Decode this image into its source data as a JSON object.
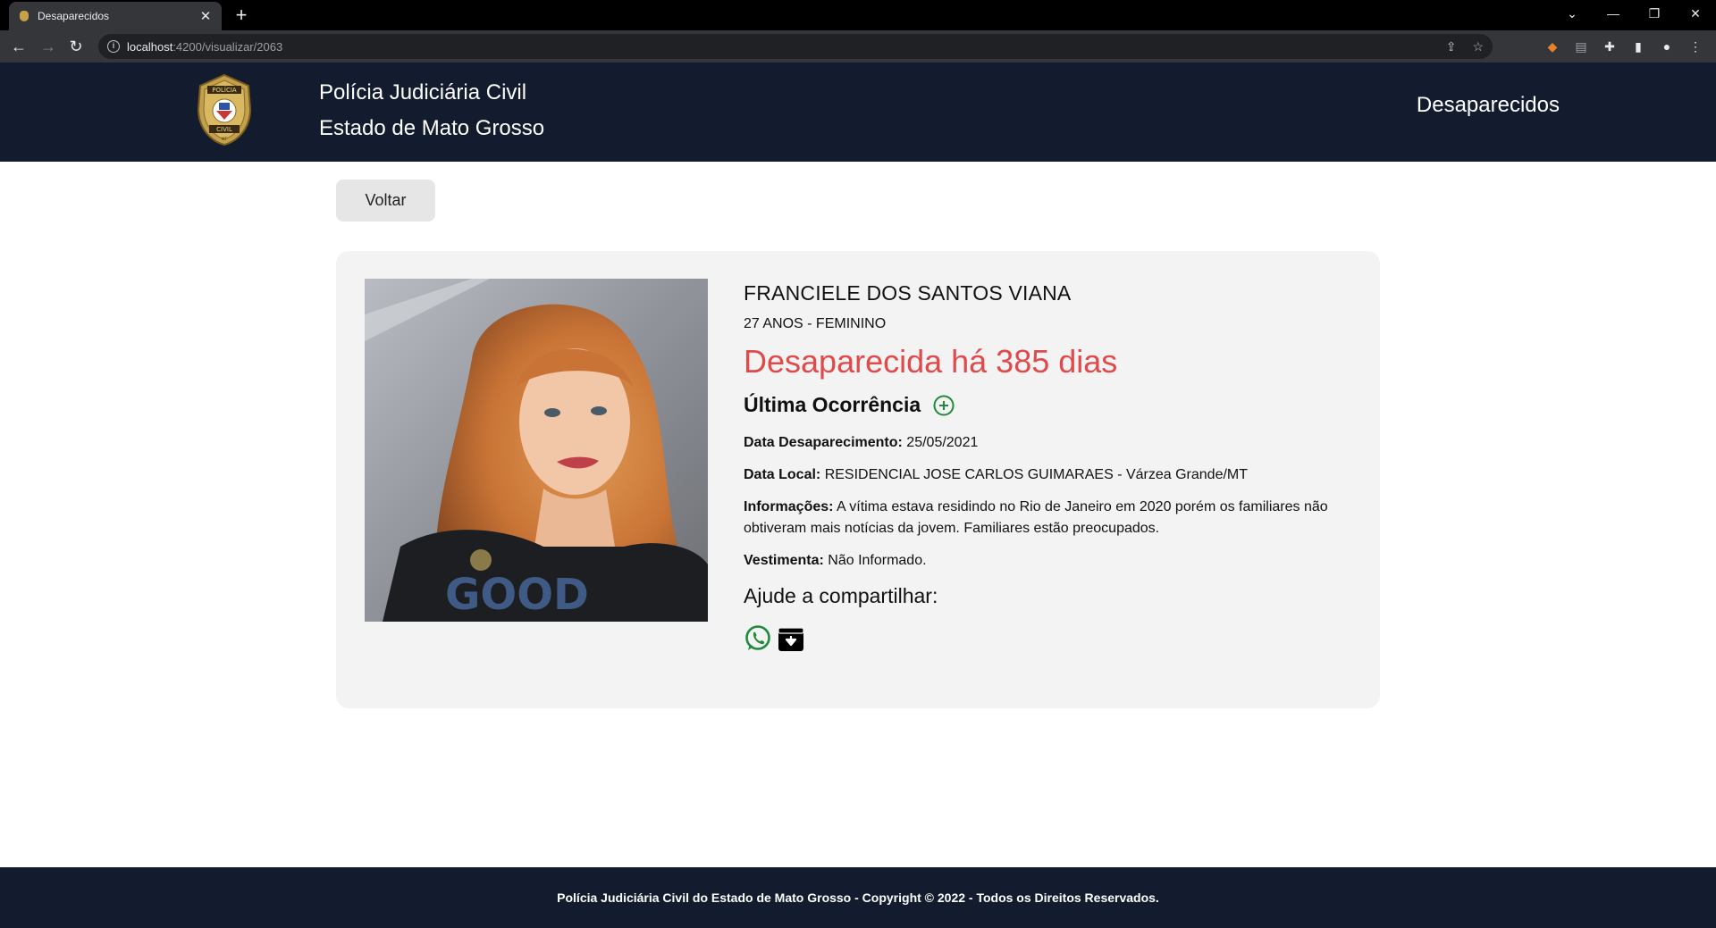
{
  "browser": {
    "tab_title": "Desaparecidos",
    "url_host": "localhost",
    "url_path": ":4200/visualizar/2063"
  },
  "header": {
    "brand_line1": "Polícia Judiciária Civil",
    "brand_line2": "Estado de Mato Grosso",
    "nav_link": "Desaparecidos",
    "badge_text_top": "POLÍCIA",
    "badge_text_bottom": "CIVIL",
    "badge_text_mt": "MT"
  },
  "main": {
    "back_label": "Voltar",
    "person": {
      "name": "FRANCIELE DOS SANTOS VIANA",
      "age_sex": "27 ANOS - FEMININO",
      "missing_text": "Desaparecida há 385 dias"
    },
    "occurrence": {
      "title": "Última Ocorrência",
      "date_label": "Data Desaparecimento:",
      "date_value": "25/05/2021",
      "place_label": "Data Local:",
      "place_value": "RESIDENCIAL JOSE CARLOS GUIMARAES - Várzea Grande/MT",
      "info_label": "Informações:",
      "info_value": "A vítima estava residindo no Rio de Janeiro em 2020 porém os familiares não obtiveram mais notícias da jovem. Familiares estão preocupados.",
      "clothing_label": "Vestimenta:",
      "clothing_value": "Não Informado."
    },
    "share_title": "Ajude a compartilhar:",
    "share_icons": [
      "whatsapp-icon",
      "download-icon"
    ],
    "colors": {
      "missing": "#e04a4a",
      "accent_green": "#1e8a3c",
      "header_bg": "#131c2e"
    }
  },
  "footer": {
    "text": "Polícia Judiciária Civil do Estado de Mato Grosso - Copyright © 2022 - Todos os Direitos Reservados."
  }
}
